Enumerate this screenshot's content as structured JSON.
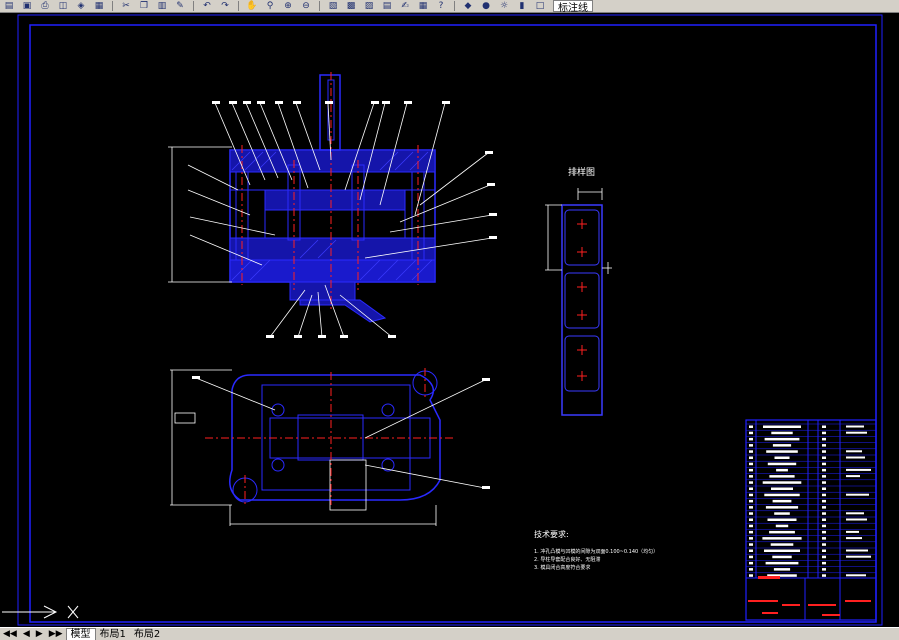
{
  "toolbar": {
    "icons": [
      "open-icon",
      "save-icon",
      "print-icon",
      "preview-icon",
      "publish-icon",
      "plot-icon",
      "cut-icon",
      "copy-icon",
      "paste-icon",
      "match-icon",
      "undo-icon",
      "redo-icon",
      "pan-icon",
      "zoom-realtime-icon",
      "zoom-window-icon",
      "zoom-previous-icon",
      "properties-icon",
      "design-center-icon",
      "tool-palette-icon",
      "sheet-set-icon",
      "markup-icon",
      "calculator-icon",
      "help-icon",
      "layer-manager-icon",
      "lightbulb-icon",
      "sun-icon",
      "lock-icon",
      "color-swatch-icon"
    ],
    "layer_name": "标注线"
  },
  "drawing": {
    "layout_title": "排样图",
    "tech_title": "技术要求:",
    "tech_notes": [
      "1. 冲孔凸模与凹模的间隙为双面0.100~0.140（均匀）",
      "2. 导柱导套配合良好、无阻滞",
      "3. 模具闭合高度符合要求"
    ]
  },
  "tabs": {
    "nav": [
      "◀◀",
      "◀",
      "▶",
      "▶▶"
    ],
    "model": "模型",
    "layout1": "布局1",
    "layout2": "布局2"
  },
  "colors": {
    "frame": "#2020ff",
    "part": "#2a2aff",
    "center": "#ff2020",
    "dim": "#ffffff",
    "strip": "#3a3aff"
  }
}
